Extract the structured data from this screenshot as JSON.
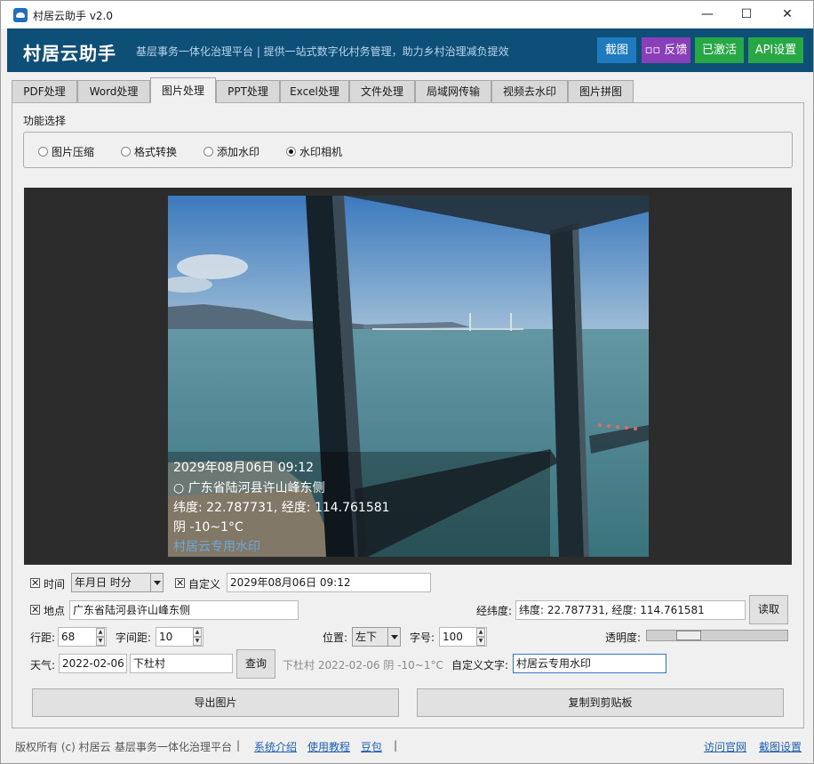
{
  "window": {
    "title": "村居云助手 v2.0",
    "minimize": "—",
    "maximize": "☐",
    "close": "✕"
  },
  "header": {
    "brand": "村居云助手",
    "slogan": "基层事务一体化治理平台 | 提供一站式数字化村务管理，助力乡村治理减负提效",
    "buttons": {
      "screenshot": "截图",
      "feedback": "▫▫ 反馈",
      "activated": "已激活",
      "api": "API设置"
    },
    "colors": {
      "header_bg": "#0e4f78",
      "screenshot": "#1f7bbf",
      "feedback": "#8a3fb8",
      "activated": "#27a844",
      "api": "#27a844"
    }
  },
  "tabs": [
    "PDF处理",
    "Word处理",
    "图片处理",
    "PPT处理",
    "Excel处理",
    "文件处理",
    "局域网传输",
    "视频去水印",
    "图片拼图"
  ],
  "active_tab": "图片处理",
  "function": {
    "label": "功能选择",
    "options": [
      "图片压缩",
      "格式转换",
      "添加水印",
      "水印相机"
    ],
    "selected": "水印相机"
  },
  "watermark": {
    "time": "2029年08月06日 09:12",
    "place": "○ 广东省陆河县许山峰东侧",
    "coords": "纬度: 22.787731, 经度: 114.761581",
    "weather": "阴 -10~1°C",
    "custom": "村居云专用水印"
  },
  "controls": {
    "time_label": "时间",
    "time_format": "年月日 时分",
    "custom_label": "自定义",
    "custom_time_value": "2029年08月06日 09:12",
    "place_label": "地点",
    "place_value": "广东省陆河县许山峰东侧",
    "coords_label": "经纬度:",
    "coords_value": "纬度: 22.787731, 经度: 114.761581",
    "read_button": "读取",
    "line_spacing_label": "行距:",
    "line_spacing_value": "68",
    "char_spacing_label": "字间距:",
    "char_spacing_value": "10",
    "position_label": "位置:",
    "position_value": "左下",
    "font_size_label": "字号:",
    "font_size_value": "100",
    "opacity_label": "透明度:",
    "opacity_level": 0.25,
    "weather_label": "天气:",
    "weather_date": "2022-02-06",
    "weather_village": "下杜村",
    "query_button": "查询",
    "weather_result": "下杜村 2022-02-06 阴 -10~1°C",
    "custom_text_label": "自定义文字:",
    "custom_text_value": "村居云专用水印",
    "spin_up": "▲",
    "spin_down": "▼"
  },
  "actions": {
    "export": "导出图片",
    "copy": "复制到剪贴板"
  },
  "status": {
    "copyright": "版权所有 (c) 村居云",
    "platform": "基层事务一体化治理平台",
    "sep": "|",
    "links": [
      "系统介绍",
      "使用教程",
      "豆包"
    ],
    "right_links": [
      "访问官网",
      "截图设置"
    ]
  }
}
